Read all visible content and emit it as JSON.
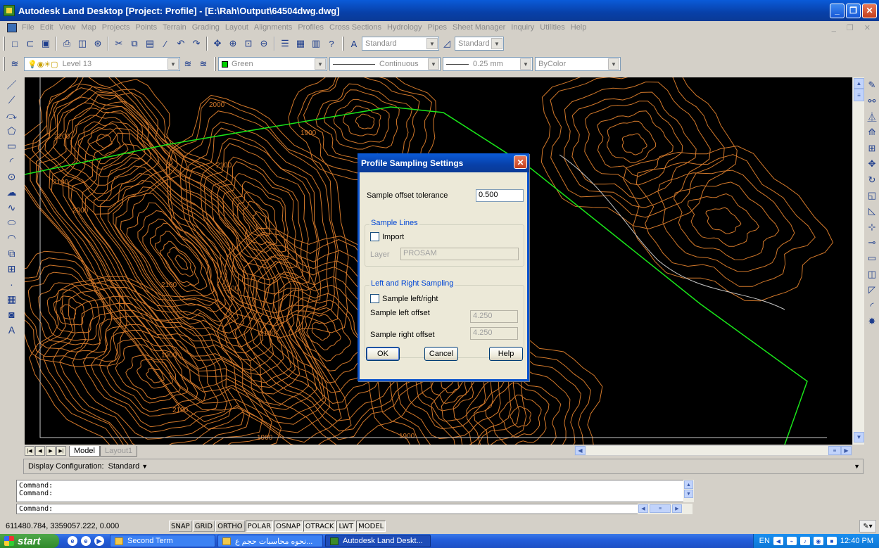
{
  "window": {
    "title": "Autodesk Land Desktop [Project: Profile] - [E:\\Rah\\Output\\64504dwg.dwg]",
    "controls": {
      "minimize": "_",
      "maximize": "❐",
      "close": "✕"
    }
  },
  "menu": {
    "items": [
      "File",
      "Edit",
      "View",
      "Map",
      "Projects",
      "Points",
      "Terrain",
      "Grading",
      "Layout",
      "Alignments",
      "Profiles",
      "Cross Sections",
      "Hydrology",
      "Pipes",
      "Sheet Manager",
      "Inquiry",
      "Utilities",
      "Help"
    ],
    "mdi_controls": "_ ❐ ✕"
  },
  "toolbar": {
    "text_style": "Standard",
    "dim_style": "Standard",
    "layer": "Level 13",
    "color": "Green",
    "linetype": "Continuous",
    "lineweight": "0.25 mm",
    "plotstyle": "ByColor"
  },
  "drawing": {
    "background": "#000000",
    "contour_color": "#d2782a",
    "alignment_color": "#19e619",
    "border_color": "#c8c8c8",
    "contour_labels": [
      "2000",
      "1900",
      "2200",
      "2100",
      "2100",
      "2000",
      "2100",
      "2100",
      "2100",
      "1900",
      "2100",
      "1900",
      "1900"
    ]
  },
  "layout_tabs": {
    "model": "Model",
    "layout1": "Layout1"
  },
  "display_config": {
    "label": "Display Configuration:",
    "value": "Standard"
  },
  "command": {
    "history": [
      "Command:",
      "Command:"
    ],
    "prompt": "Command:"
  },
  "status": {
    "coords": "611480.784, 3359057.222, 0.000",
    "buttons": [
      {
        "label": "SNAP",
        "on": false
      },
      {
        "label": "GRID",
        "on": false
      },
      {
        "label": "ORTHO",
        "on": false
      },
      {
        "label": "POLAR",
        "on": true
      },
      {
        "label": "OSNAP",
        "on": true
      },
      {
        "label": "OTRACK",
        "on": true
      },
      {
        "label": "LWT",
        "on": true
      },
      {
        "label": "MODEL",
        "on": true
      }
    ]
  },
  "taskbar": {
    "start": "start",
    "items": [
      {
        "label": "Second Term",
        "active": false
      },
      {
        "label": "نحوه محاسبات حجم ع...",
        "active": false
      },
      {
        "label": "Autodesk Land Deskt...",
        "active": true
      }
    ],
    "language": "EN",
    "clock": "12:40 PM"
  },
  "dialog": {
    "title": "Profile Sampling Settings",
    "tolerance_label": "Sample offset tolerance",
    "tolerance_value": "0.500",
    "sample_lines_group": "Sample Lines",
    "import_label": "Import",
    "import_checked": false,
    "layer_label": "Layer",
    "layer_value": "PROSAM",
    "lr_group": "Left and Right Sampling",
    "lr_checkbox": "Sample left/right",
    "lr_checked": false,
    "left_offset_label": "Sample left offset",
    "left_offset_value": "4.250",
    "right_offset_label": "Sample right offset",
    "right_offset_value": "4.250",
    "ok": "OK",
    "cancel": "Cancel",
    "help": "Help"
  }
}
